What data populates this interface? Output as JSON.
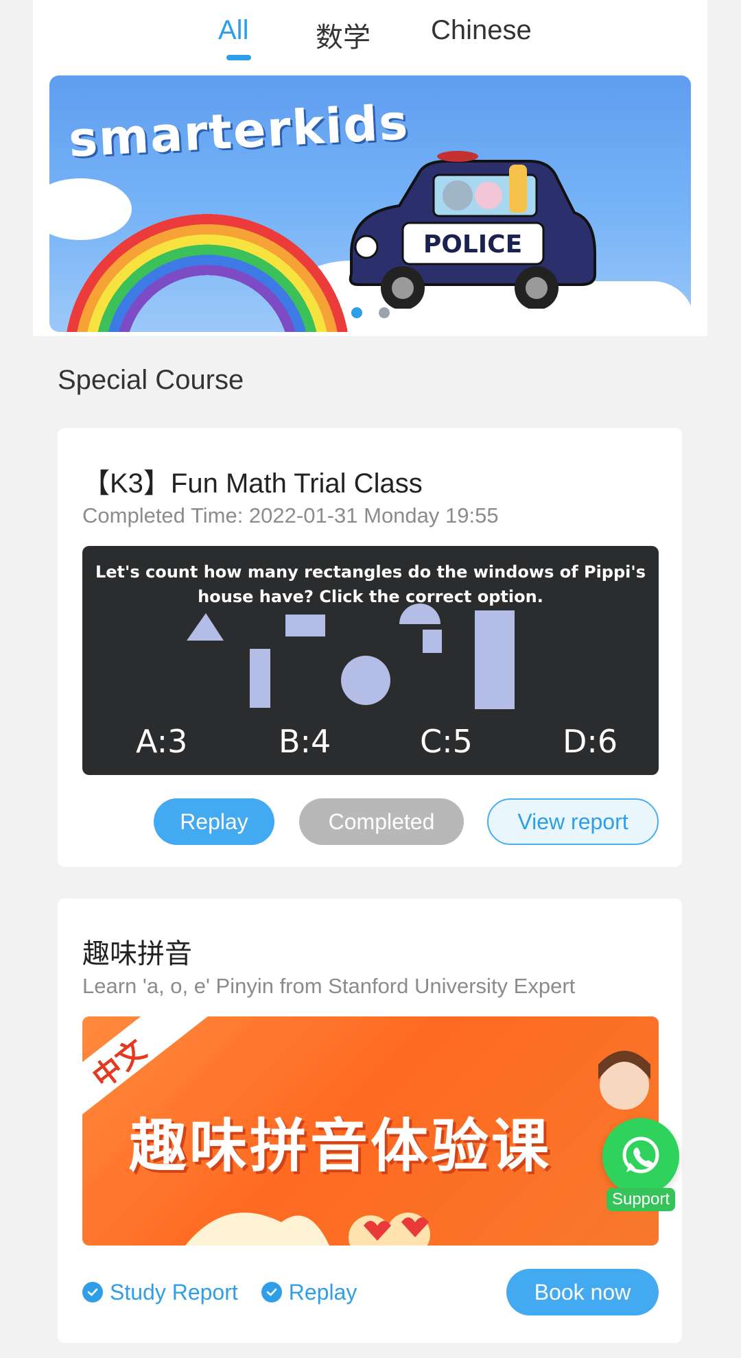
{
  "tabs": [
    {
      "label": "All",
      "active": true
    },
    {
      "label": "数学",
      "active": false
    },
    {
      "label": "Chinese",
      "active": false
    }
  ],
  "banner": {
    "logo_text": "smarterkids",
    "car_text": "POLICE",
    "dots": 2,
    "active_dot": 0
  },
  "section": {
    "title": "Special Course"
  },
  "course1": {
    "title": "【K3】Fun Math Trial Class",
    "subtitle": "Completed Time: 2022-01-31 Monday 19:55",
    "question_line1": "Let's count  how many rectangles do the windows of Pippi's",
    "question_line2": "house have? Click the correct option.",
    "options": [
      "A:3",
      "B:4",
      "C:5",
      "D:6"
    ],
    "buttons": {
      "replay": "Replay",
      "completed": "Completed",
      "report": "View report"
    }
  },
  "course2": {
    "title": "趣味拼音",
    "subtitle": "Learn 'a, o, e' Pinyin from Stanford University Expert",
    "promo_corner": "中文",
    "promo_title": "趣味拼音体验课",
    "links": [
      "Study Report",
      "Replay"
    ],
    "book_button": "Book now"
  },
  "support": {
    "label": "Support"
  },
  "colors": {
    "accent": "#2f9ee8",
    "completed": "#b8b8b8",
    "whatsapp": "#2fd25b"
  }
}
